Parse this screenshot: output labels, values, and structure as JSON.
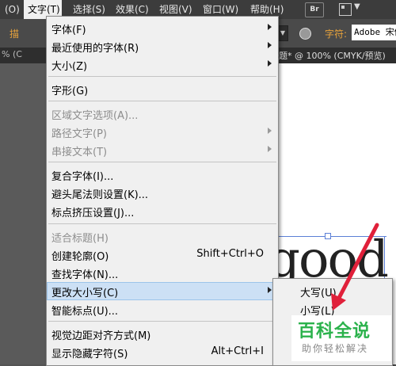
{
  "menubar": {
    "items": [
      {
        "label": "(O)"
      },
      {
        "label": "文字(T)"
      },
      {
        "label": "选择(S)"
      },
      {
        "label": "效果(C)"
      },
      {
        "label": "视图(V)"
      },
      {
        "label": "窗口(W)"
      },
      {
        "label": "帮助(H)"
      }
    ],
    "bridge_badge": "Br"
  },
  "control_bar": {
    "left_label": "描",
    "char_label": "字符:",
    "font_value": "Adobe 宋体"
  },
  "doc_tabs": {
    "zoom_left": "% (C",
    "title": "题* @ 100% (CMYK/预览)"
  },
  "canvas": {
    "text": "good"
  },
  "type_menu": {
    "items": [
      {
        "label": "字体(F)",
        "submenu": true
      },
      {
        "label": "最近使用的字体(R)",
        "submenu": true
      },
      {
        "label": "大小(Z)",
        "submenu": true
      },
      {
        "label": "字形(G)"
      },
      {
        "label": "区域文字选项(A)...",
        "disabled": true
      },
      {
        "label": "路径文字(P)",
        "disabled": true,
        "submenu": true
      },
      {
        "label": "串接文本(T)",
        "disabled": true,
        "submenu": true
      },
      {
        "label": "复合字体(I)..."
      },
      {
        "label": "避头尾法则设置(K)..."
      },
      {
        "label": "标点挤压设置(J)..."
      },
      {
        "label": "适合标题(H)",
        "disabled": true
      },
      {
        "label": "创建轮廓(O)",
        "shortcut": "Shift+Ctrl+O"
      },
      {
        "label": "查找字体(N)..."
      },
      {
        "label": "更改大小写(C)",
        "submenu": true,
        "highlighted": true
      },
      {
        "label": "智能标点(U)..."
      },
      {
        "label": "视觉边距对齐方式(M)"
      },
      {
        "label": "显示隐藏字符(S)",
        "shortcut": "Alt+Ctrl+I"
      }
    ]
  },
  "change_case_submenu": {
    "items": [
      {
        "label": "大写(U)"
      },
      {
        "label": "小写(L)"
      }
    ]
  },
  "watermark": {
    "title": "百科全说",
    "subtitle": "助你轻松解决"
  },
  "colors": {
    "accent_orange": "#e8a33b",
    "highlight": "#cce0f5",
    "arrow_red": "#e0203a",
    "watermark_green": "#2bb24c"
  }
}
